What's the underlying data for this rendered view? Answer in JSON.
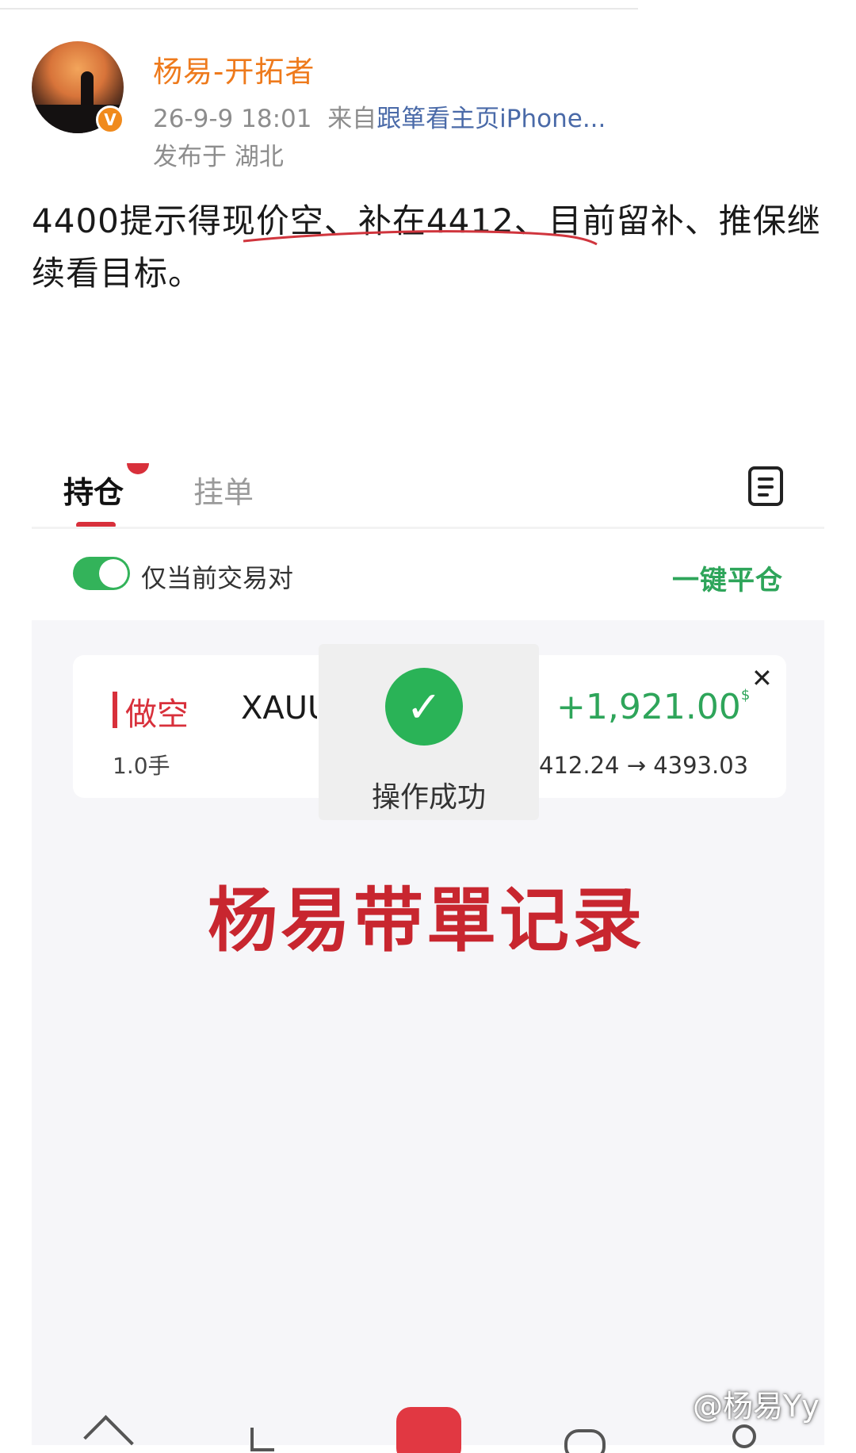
{
  "post": {
    "username": "杨易-开拓者",
    "verified_badge": "V",
    "time": "26-9-9 18:01",
    "via_prefix": "来自",
    "via_link": "跟箪看主页iPhone...",
    "location": "发布于 湖北",
    "content": "4400提示得现价空、补在4412、目前留补、推保继续看目标。"
  },
  "app": {
    "tabs": [
      "持仓",
      "挂单"
    ],
    "toggle_label": "仅当前交易对",
    "toggle_on": true,
    "close_all_label": "一键平仓",
    "position": {
      "side": "做空",
      "symbol": "XAUUSD",
      "lots": "1.0手",
      "pnl": "+1,921.00",
      "currency": "$",
      "prices": "412.24 → 4393.03",
      "close_symbol": "✕"
    },
    "toast": {
      "icon": "check-circle-icon",
      "message": "操作成功"
    },
    "watermark_text": "杨易带單记录"
  },
  "corner_watermark": "@杨易Yy",
  "colors": {
    "username": "#ee7a1c",
    "link": "#4a6aa8",
    "short": "#d8303b",
    "profit": "#2ea55a",
    "toggle": "#33b35a",
    "watermark": "#c8262f"
  }
}
